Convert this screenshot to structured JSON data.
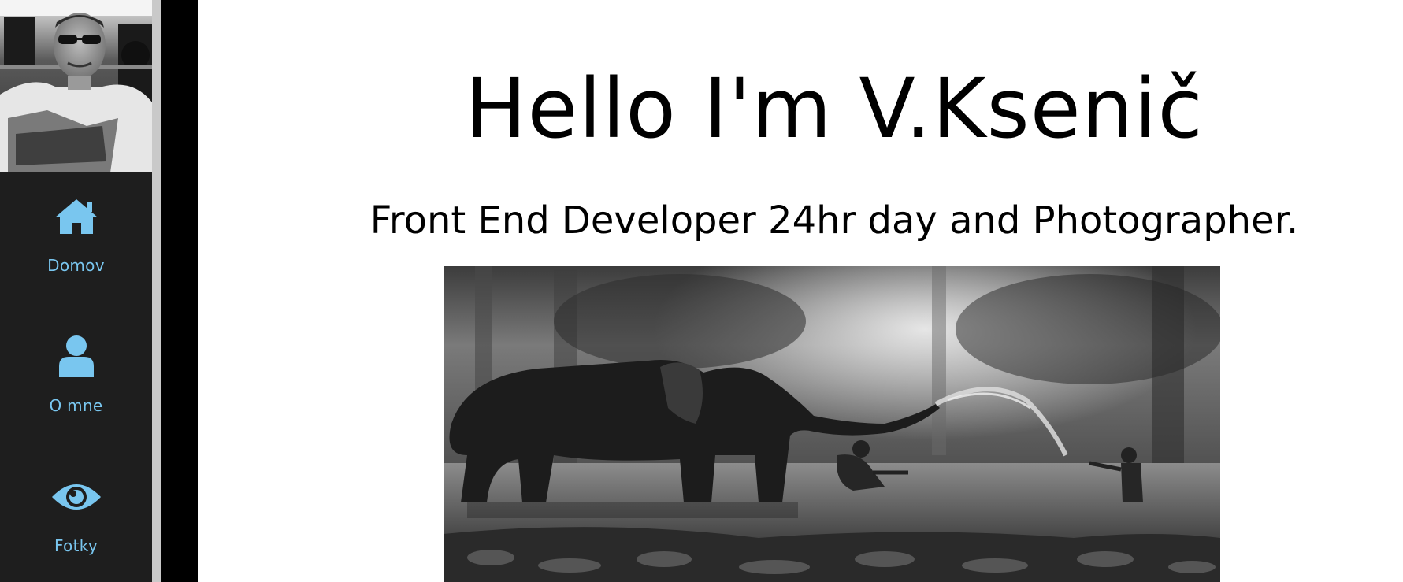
{
  "sidebar": {
    "items": [
      {
        "label": "Domov",
        "icon": "home-icon"
      },
      {
        "label": "O mne",
        "icon": "user-icon"
      },
      {
        "label": "Fotky",
        "icon": "eye-icon"
      }
    ],
    "accent_color": "#79c6ef",
    "background_color": "#1e1e1e"
  },
  "hero": {
    "title": "Hello I'm V.Ksenič",
    "subtitle": "Front End Developer 24hr day and Photographer."
  }
}
